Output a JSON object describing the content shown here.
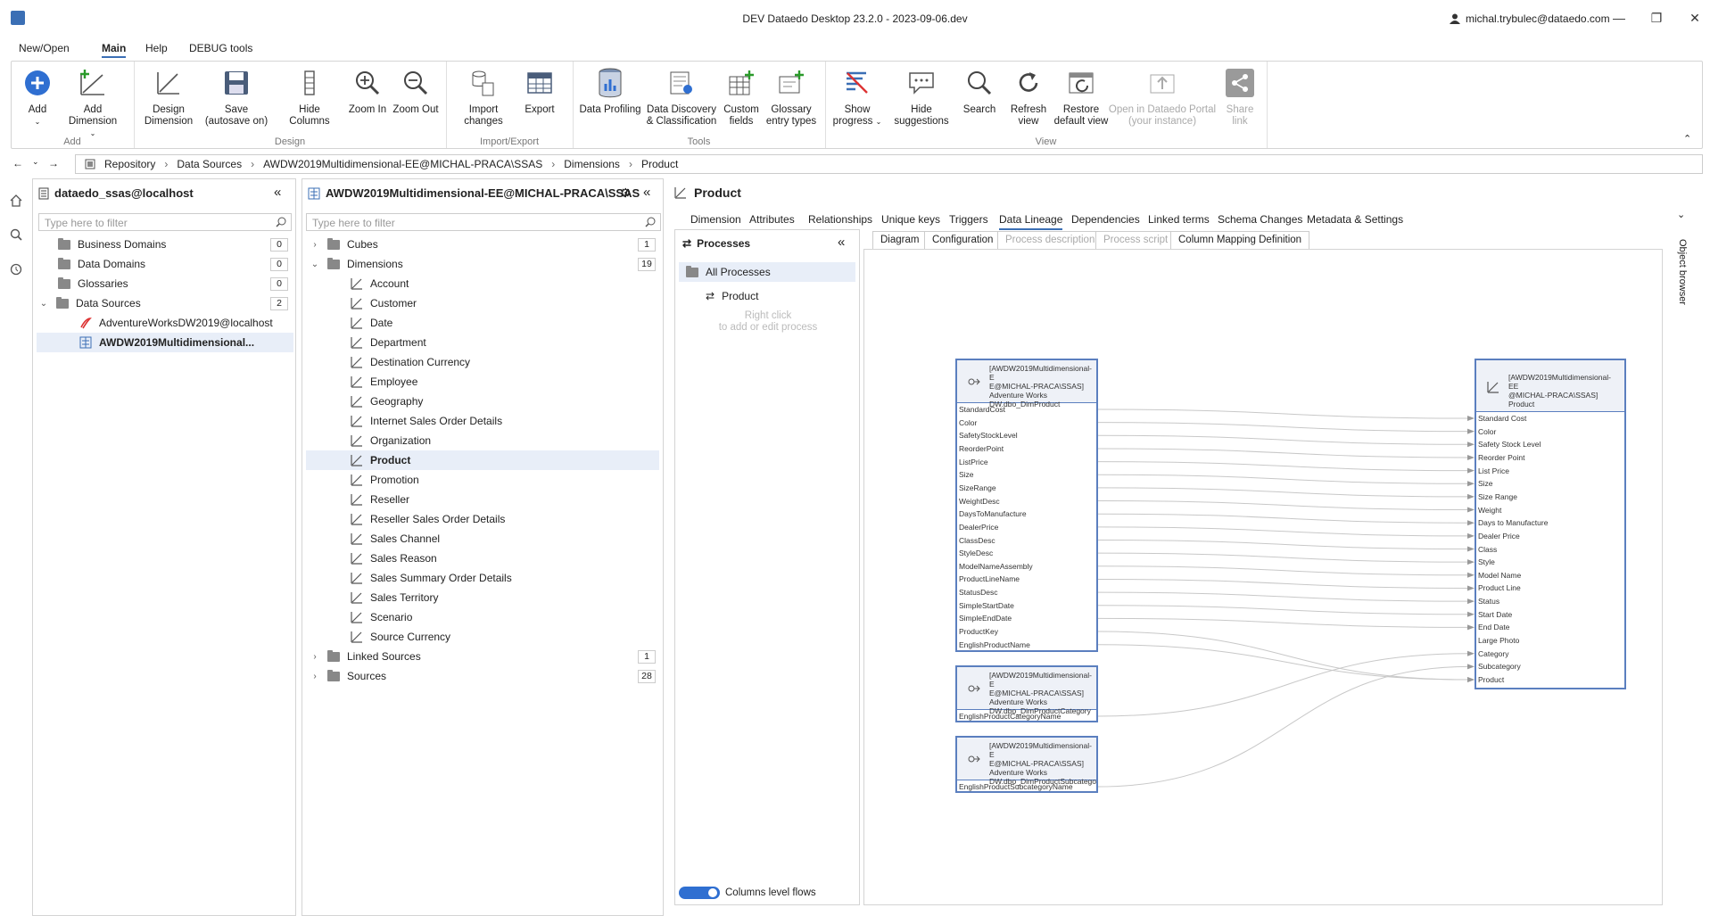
{
  "app": {
    "title": "DEV Dataedo Desktop 23.2.0 - 2023-09-06.dev",
    "user": "michal.trybulec@dataedo.com"
  },
  "menu": {
    "items": [
      "New/Open",
      "Main",
      "Help",
      "DEBUG tools"
    ],
    "active": "Main"
  },
  "ribbon": {
    "buttons": {
      "add": "Add",
      "add_dimension": "Add Dimension",
      "design_dimension_1": "Design",
      "design_dimension_2": "Dimension",
      "save_1": "Save",
      "save_2": "(autosave on)",
      "hide_columns": "Hide Columns",
      "zoom_in": "Zoom In",
      "zoom_out": "Zoom Out",
      "import_1": "Import",
      "import_2": "changes",
      "export": "Export",
      "data_profiling": "Data Profiling",
      "discovery_1": "Data Discovery",
      "discovery_2": "& Classification",
      "custom_1": "Custom",
      "custom_2": "fields",
      "glossary_1": "Glossary",
      "glossary_2": "entry types",
      "show_progress_1": "Show",
      "show_progress_2": "progress",
      "hide_sugg_1": "Hide",
      "hide_sugg_2": "suggestions",
      "search": "Search",
      "refresh_1": "Refresh",
      "refresh_2": "view",
      "restore_1": "Restore",
      "restore_2": "default view",
      "portal_1": "Open in Dataedo Portal",
      "portal_2": "(your instance)",
      "share_1": "Share",
      "share_2": "link"
    },
    "groups": {
      "add": "Add",
      "design": "Design",
      "import_export": "Import/Export",
      "tools": "Tools",
      "view": "View"
    }
  },
  "breadcrumb": [
    "Repository",
    "Data Sources",
    "AWDW2019Multidimensional-EE@MICHAL-PRACA\\SSAS",
    "Dimensions",
    "Product"
  ],
  "repo_panel": {
    "title": "dataedo_ssas@localhost",
    "filter_placeholder": "Type here to filter",
    "items": [
      {
        "label": "Business Domains",
        "count": "0"
      },
      {
        "label": "Data Domains",
        "count": "0"
      },
      {
        "label": "Glossaries",
        "count": "0"
      },
      {
        "label": "Data Sources",
        "count": "2"
      }
    ],
    "sources": [
      "AdventureWorksDW2019@localhost",
      "AWDW2019Multidimensional..."
    ]
  },
  "tree_panel": {
    "title": "AWDW2019Multidimensional-EE@MICHAL-PRACA\\SSAS",
    "filter_placeholder": "Type here to filter",
    "cubes": {
      "label": "Cubes",
      "count": "1"
    },
    "dimensions": {
      "label": "Dimensions",
      "count": "19"
    },
    "dimension_items": [
      "Account",
      "Customer",
      "Date",
      "Department",
      "Destination Currency",
      "Employee",
      "Geography",
      "Internet Sales Order Details",
      "Organization",
      "Product",
      "Promotion",
      "Reseller",
      "Reseller Sales Order Details",
      "Sales Channel",
      "Sales Reason",
      "Sales Summary Order Details",
      "Sales Territory",
      "Scenario",
      "Source Currency"
    ],
    "linked_sources": {
      "label": "Linked Sources",
      "count": "1"
    },
    "sources": {
      "label": "Sources",
      "count": "28"
    }
  },
  "detail": {
    "title": "Product",
    "tabs": [
      "Dimension",
      "Attributes",
      "Relationships",
      "Unique keys",
      "Triggers",
      "Data Lineage",
      "Dependencies",
      "Linked terms",
      "Schema Changes",
      "Metadata & Settings"
    ],
    "active_tab": "Data Lineage"
  },
  "processes": {
    "title": "Processes",
    "all": "All Processes",
    "product": "Product",
    "hint_1": "Right click",
    "hint_2": "to add or edit process",
    "toggle_label": "Columns level flows"
  },
  "lineage_tabs": [
    "Diagram",
    "Configuration",
    "Process description",
    "Process script",
    "Column Mapping Definition"
  ],
  "diagram": {
    "source1": {
      "header": [
        "[AWDW2019Multidimensional-E",
        "E@MICHAL-PRACA\\SSAS]",
        "Adventure Works",
        "DW.dbo_DimProduct"
      ],
      "columns": [
        "StandardCost",
        "Color",
        "SafetyStockLevel",
        "ReorderPoint",
        "ListPrice",
        "Size",
        "SizeRange",
        "WeightDesc",
        "DaysToManufacture",
        "DealerPrice",
        "ClassDesc",
        "StyleDesc",
        "ModelNameAssembly",
        "ProductLineName",
        "StatusDesc",
        "SimpleStartDate",
        "SimpleEndDate",
        "ProductKey",
        "EnglishProductName"
      ]
    },
    "source2": {
      "header": [
        "[AWDW2019Multidimensional-E",
        "E@MICHAL-PRACA\\SSAS]",
        "Adventure Works",
        "DW.dbo_DimProductCategory"
      ],
      "columns": [
        "EnglishProductCategoryName"
      ]
    },
    "source3": {
      "header": [
        "[AWDW2019Multidimensional-E",
        "E@MICHAL-PRACA\\SSAS]",
        "Adventure Works",
        "DW.dbo_DimProductSubcatego"
      ],
      "columns": [
        "EnglishProductSubcategoryName"
      ]
    },
    "target": {
      "header": [
        "[AWDW2019Multidimensional-EE",
        "@MICHAL-PRACA\\SSAS]",
        "Product"
      ],
      "columns": [
        "Standard Cost",
        "Color",
        "Safety Stock Level",
        "Reorder Point",
        "List Price",
        "Size",
        "Size Range",
        "Weight",
        "Days to Manufacture",
        "Dealer Price",
        "Class",
        "Style",
        "Model Name",
        "Product Line",
        "Status",
        "Start Date",
        "End Date",
        "Large Photo",
        "Category",
        "Subcategory",
        "Product"
      ]
    }
  },
  "object_browser": "Object browser",
  "colors": {
    "accent": "#3b6fb5",
    "entity_border": "#5b7fbf",
    "toggle": "#2f6fd1"
  }
}
